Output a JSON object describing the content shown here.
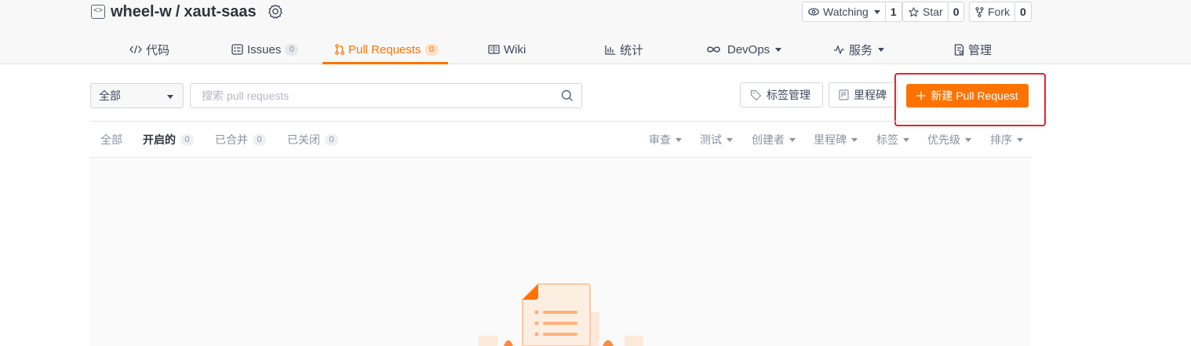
{
  "repo": {
    "owner": "wheel-w",
    "separator": "/",
    "name": "xaut-saas"
  },
  "social": {
    "watch_label": "Watching",
    "watch_count": "1",
    "star_label": "Star",
    "star_count": "0",
    "fork_label": "Fork",
    "fork_count": "0"
  },
  "tabs": [
    {
      "label": "代码",
      "icon": "code-icon"
    },
    {
      "label": "Issues",
      "count": "0",
      "icon": "issues-icon"
    },
    {
      "label": "Pull Requests",
      "count": "0",
      "icon": "pull-request-icon",
      "active": true
    },
    {
      "label": "Wiki",
      "icon": "wiki-icon"
    },
    {
      "label": "统计",
      "icon": "stats-icon"
    },
    {
      "label": "DevOps",
      "icon": "infinity-icon"
    },
    {
      "label": "服务",
      "icon": "pulse-icon"
    },
    {
      "label": "管理",
      "icon": "manage-icon"
    }
  ],
  "filter": {
    "selected": "全部",
    "search_placeholder": "搜索 pull requests"
  },
  "actions": {
    "labels_button": "标签管理",
    "milestones_button": "里程碑",
    "new_pr_button": "新建 Pull Request"
  },
  "state_tabs": [
    {
      "label": "全部"
    },
    {
      "label": "开启的",
      "count": "0",
      "active": true
    },
    {
      "label": "已合并",
      "count": "0"
    },
    {
      "label": "已关闭",
      "count": "0"
    }
  ],
  "sort_filters": [
    "审查",
    "测试",
    "创建者",
    "里程碑",
    "标签",
    "优先级",
    "排序"
  ],
  "colors": {
    "accent": "#fe7300",
    "highlight": "#e0262e",
    "text": "#40485b",
    "muted": "#8c92a4"
  }
}
